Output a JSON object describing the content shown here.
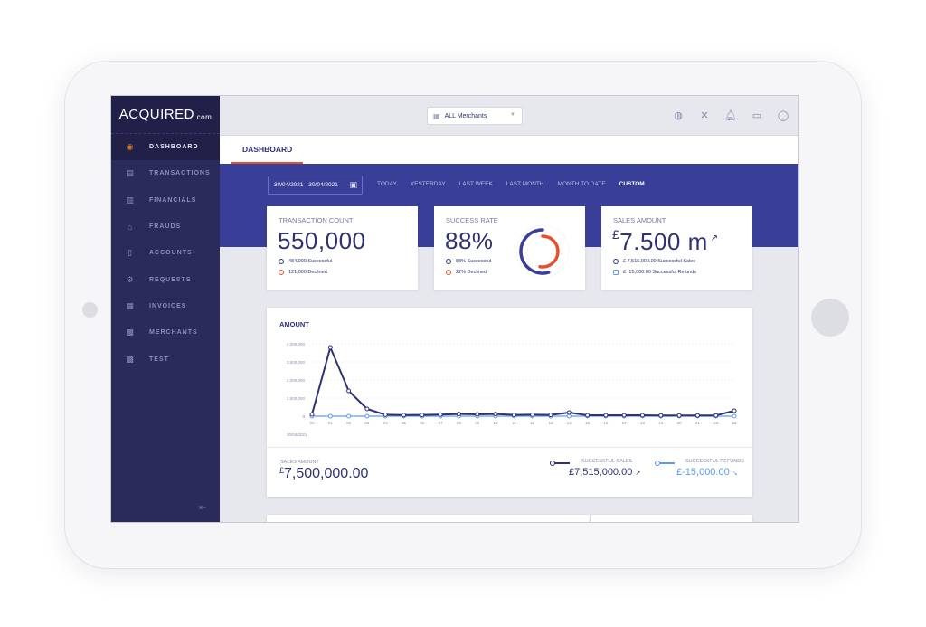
{
  "app": {
    "logo_main": "ACQUIRED",
    "logo_suffix": ".com"
  },
  "sidebar": {
    "items": [
      {
        "label": "DASHBOARD",
        "icon": "dashboard-icon",
        "active": true
      },
      {
        "label": "TRANSACTIONS",
        "icon": "transactions-icon",
        "active": false
      },
      {
        "label": "FINANCIALS",
        "icon": "financials-icon",
        "active": false
      },
      {
        "label": "FRAUDS",
        "icon": "frauds-icon",
        "active": false
      },
      {
        "label": "ACCOUNTS",
        "icon": "accounts-icon",
        "active": false
      },
      {
        "label": "REQUESTS",
        "icon": "requests-icon",
        "active": false
      },
      {
        "label": "INVOICES",
        "icon": "invoices-icon",
        "active": false
      },
      {
        "label": "MERCHANTS",
        "icon": "merchants-icon",
        "active": false
      },
      {
        "label": "TEST",
        "icon": "test-icon",
        "active": false
      }
    ],
    "logout_icon": "logout-icon"
  },
  "header": {
    "merchant_select": "ALL Merchants",
    "icons": [
      "globe-icon",
      "tools-icon",
      "bell-icon",
      "message-icon",
      "user-icon"
    ]
  },
  "tabs": [
    {
      "label": "DASHBOARD",
      "active": true
    }
  ],
  "filters": {
    "date_range": "30/04/2021 - 30/04/2021",
    "presets": [
      {
        "label": "TODAY",
        "active": false
      },
      {
        "label": "YESTERDAY",
        "active": false
      },
      {
        "label": "LAST WEEK",
        "active": false
      },
      {
        "label": "LAST MONTH",
        "active": false
      },
      {
        "label": "MONTH TO DATE",
        "active": false
      },
      {
        "label": "CUSTOM",
        "active": true
      }
    ]
  },
  "kpis": {
    "transaction_count": {
      "title": "TRANSACTION COUNT",
      "value": "550,000",
      "successful": "484,000 Successful",
      "declined": "121,000 Declined"
    },
    "success_rate": {
      "title": "SUCCESS RATE",
      "value": "88%",
      "successful": "88% Successful",
      "declined": "22% Declined",
      "success_fraction": 0.88,
      "declined_fraction": 0.22
    },
    "sales_amount": {
      "title": "SALES AMOUNT",
      "currency": "£",
      "value": "7.500 m",
      "successful_sales": "£ 7,515,000.00 Successful Sales",
      "successful_refunds": "£ -15,000.00 Successful Refunds"
    }
  },
  "colors": {
    "primary": "#2e3173",
    "band": "#393f99",
    "accent": "#e8502a",
    "refunds": "#5a9cf0",
    "sidebar": "#2a2b5a"
  },
  "chart_data": {
    "type": "line",
    "title": "AMOUNT",
    "xlabel": "30/04/2021",
    "ylabel": "",
    "x": [
      "00",
      "01",
      "02",
      "03",
      "04",
      "05",
      "06",
      "07",
      "08",
      "09",
      "10",
      "11",
      "12",
      "13",
      "14",
      "15",
      "16",
      "17",
      "18",
      "19",
      "20",
      "21",
      "22",
      "23"
    ],
    "ylim": [
      0,
      4000000
    ],
    "yticks": [
      0,
      1000000,
      2000000,
      3000000,
      4000000
    ],
    "ytick_labels": [
      "0",
      "1,000,000",
      "2,000,000",
      "3,000,000",
      "4,000,000"
    ],
    "grid": true,
    "series": [
      {
        "name": "Successful Sales",
        "color": "#2e3173",
        "values": [
          100000,
          3800000,
          1400000,
          400000,
          80000,
          60000,
          70000,
          90000,
          120000,
          100000,
          120000,
          70000,
          80000,
          70000,
          200000,
          50000,
          50000,
          50000,
          50000,
          40000,
          40000,
          40000,
          40000,
          300000
        ]
      },
      {
        "name": "Successful Refunds",
        "color": "#5a9cf0",
        "values": [
          0,
          0,
          0,
          0,
          0,
          0,
          0,
          0,
          0,
          0,
          0,
          0,
          0,
          0,
          0,
          0,
          0,
          0,
          0,
          0,
          0,
          0,
          0,
          0
        ]
      }
    ]
  },
  "summary": {
    "sales_amount_label": "SALES AMOUNT",
    "sales_amount_currency": "£",
    "sales_amount_value": "7,500,000.00",
    "successful_sales_label": "SUCCESSFUL SALES",
    "successful_sales_value": "£7,515,000.00",
    "successful_sales_trend": "↗",
    "successful_refunds_label": "SUCCESSFUL REFUNDS",
    "successful_refunds_value": "£-15,000.00",
    "successful_refunds_trend": "↘"
  }
}
